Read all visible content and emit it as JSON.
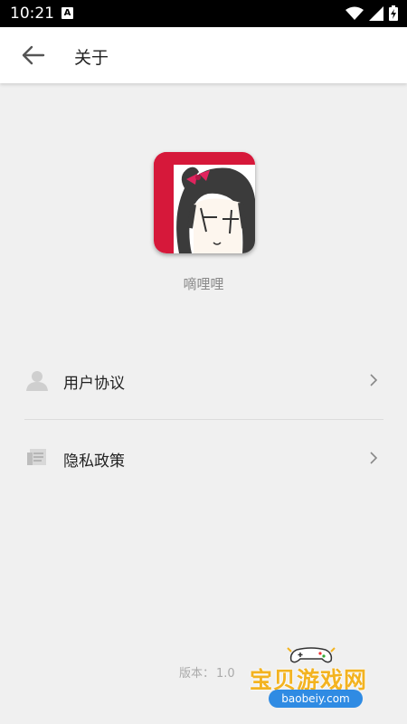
{
  "status_bar": {
    "time": "10:21",
    "notification_letter": "A",
    "icons": [
      "wifi-icon",
      "signal-icon",
      "battery-charging-icon"
    ]
  },
  "app_bar": {
    "back_icon": "arrow-left-icon",
    "title": "关于"
  },
  "app": {
    "name": "嘀哩哩",
    "logo_colors": {
      "red": "#d6183a",
      "hair": "#3b3b3b",
      "ribbon": "#e0245e"
    }
  },
  "menu": [
    {
      "label": "用户协议",
      "icon": "user-icon",
      "chevron": "chevron-right-icon"
    },
    {
      "label": "隐私政策",
      "icon": "document-icon",
      "chevron": "chevron-right-icon"
    }
  ],
  "version": {
    "label": "版本：",
    "value": "1.0"
  },
  "watermark": {
    "title": "宝贝游戏网",
    "url": "baobeiy.com"
  }
}
